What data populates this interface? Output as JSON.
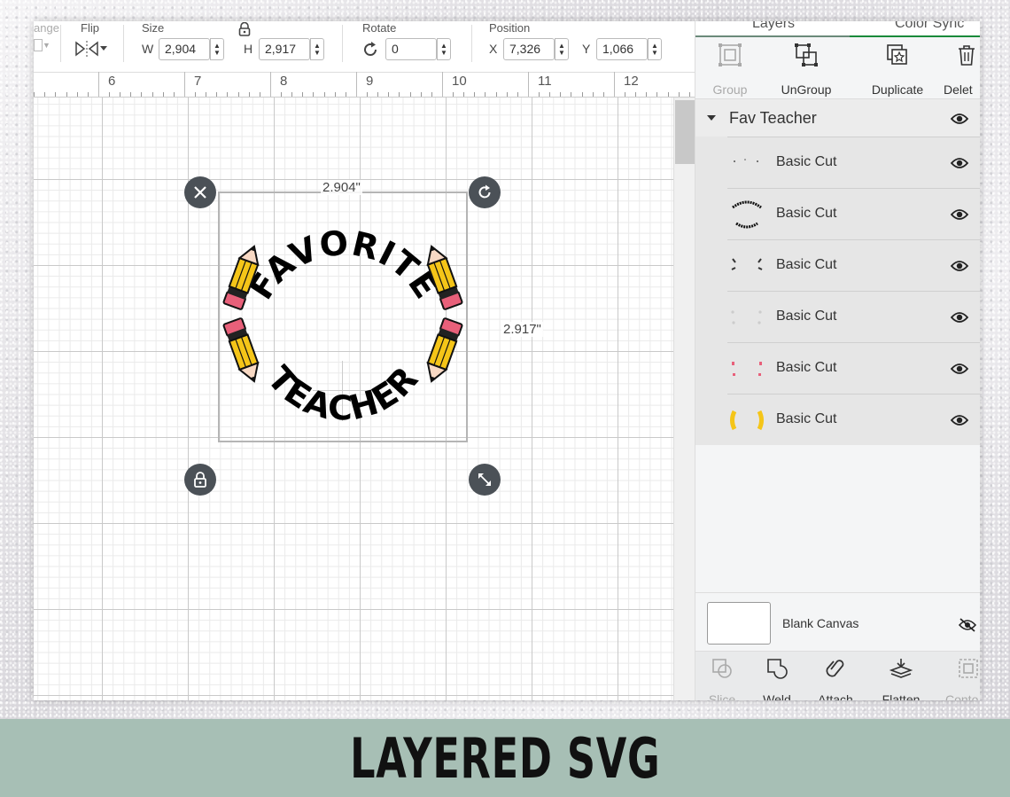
{
  "toolbar": {
    "arrange_label": "ange",
    "flip_label": "Flip",
    "size_label": "Size",
    "w_label": "W",
    "w_value": "2,904",
    "h_label": "H",
    "h_value": "2,917",
    "rotate_label": "Rotate",
    "rotate_value": "0",
    "position_label": "Position",
    "x_label": "X",
    "x_value": "7,326",
    "y_label": "Y",
    "y_value": "1,066"
  },
  "ruler": [
    "6",
    "7",
    "8",
    "9",
    "10",
    "11",
    "12"
  ],
  "canvas": {
    "width_dim": "2.904\"",
    "height_dim": "2.917\"",
    "design_top_text": "FAVORITE",
    "design_bottom_text": "TEACHER"
  },
  "panel": {
    "tabs": [
      "Layers",
      "Color Sync"
    ],
    "actions": [
      {
        "label": "Group",
        "icon": "group-icon",
        "enabled": false
      },
      {
        "label": "UnGroup",
        "icon": "ungroup-icon",
        "enabled": true
      },
      {
        "label": "Duplicate",
        "icon": "duplicate-icon",
        "enabled": true
      },
      {
        "label": "Delet",
        "icon": "trash-icon",
        "enabled": true
      }
    ],
    "group_name": "Fav Teacher",
    "layers": [
      {
        "name": "Basic Cut",
        "thumb": "dots"
      },
      {
        "name": "Basic Cut",
        "thumb": "text"
      },
      {
        "name": "Basic Cut",
        "thumb": "tips"
      },
      {
        "name": "Basic Cut",
        "thumb": "light"
      },
      {
        "name": "Basic Cut",
        "thumb": "pink"
      },
      {
        "name": "Basic Cut",
        "thumb": "yellow"
      }
    ],
    "blank_canvas_label": "Blank Canvas",
    "bottom_actions": [
      {
        "label": "Slice",
        "icon": "slice-icon",
        "enabled": false
      },
      {
        "label": "Weld",
        "icon": "weld-icon",
        "enabled": true
      },
      {
        "label": "Attach",
        "icon": "paperclip-icon",
        "enabled": true
      },
      {
        "label": "Flatten",
        "icon": "flatten-icon",
        "enabled": true
      },
      {
        "label": "Conto",
        "icon": "contour-icon",
        "enabled": false
      }
    ]
  },
  "banner": {
    "text": "LAYERED SVG"
  },
  "colors": {
    "accent_green": "#1a8a3a",
    "banner_bg": "#a7bfb5",
    "handle": "#4b5157",
    "pencil_yellow": "#f5c518",
    "eraser_pink": "#e8607a"
  }
}
